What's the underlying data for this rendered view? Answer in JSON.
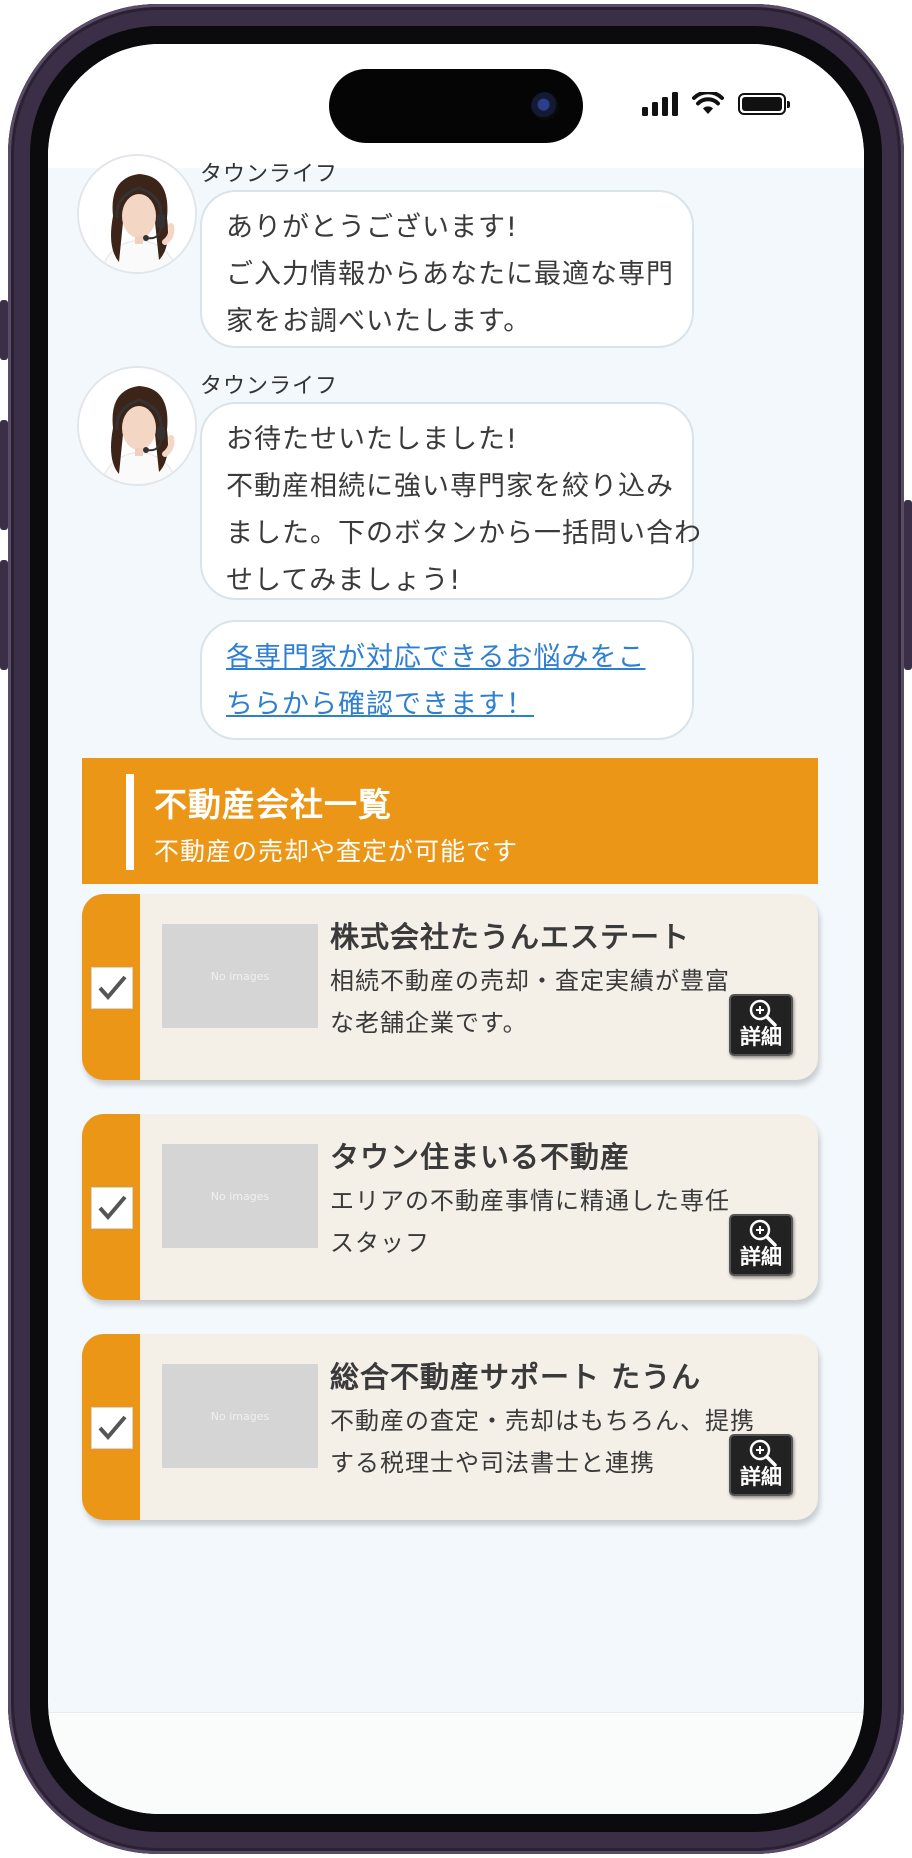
{
  "status_bar": {
    "signal_icon": "cellular-signal-icon",
    "wifi_icon": "wifi-icon",
    "battery_icon": "battery-icon",
    "battery_level": 1.0
  },
  "chat": {
    "messages": [
      {
        "sender": "タウンライフ",
        "lines": [
          "ありがとうございます!",
          "ご入力情報からあなたに最適な専門",
          "家をお調べいたします。"
        ]
      },
      {
        "sender": "タウンライフ",
        "lines": [
          "お待たせいたしました!",
          "不動産相続に強い専門家を絞り込み",
          "ました。下のボタンから一括問い合わ",
          "せしてみましょう!"
        ]
      }
    ],
    "link": {
      "lines": [
        "各専門家が対応できるお悩みをこ",
        "ちらから確認できます！"
      ]
    }
  },
  "section": {
    "title": "不動産会社一覧",
    "subtitle": "不動産の売却や査定が可能です"
  },
  "companies": [
    {
      "name": "株式会社たうんエステート",
      "desc_lines": [
        "相続不動産の売却・査定実績が豊富",
        "な老舗企業です。"
      ],
      "thumb_text": "No images",
      "detail_label": "詳細",
      "checked": true
    },
    {
      "name": "タウン住まいる不動産",
      "desc_lines": [
        "エリアの不動産事情に精通した専任",
        "スタッフ"
      ],
      "thumb_text": "No images",
      "detail_label": "詳細",
      "checked": true
    },
    {
      "name": "総合不動産サポート たうん",
      "desc_lines": [
        "不動産の査定・売却はもちろん、提携",
        "する税理士や司法書士と連携"
      ],
      "thumb_text": "No images",
      "detail_label": "詳細",
      "checked": true
    }
  ],
  "colors": {
    "accent": "#eb9616",
    "link": "#2f7fd1",
    "background": "#f2f8fc",
    "card": "#f4f0e8"
  }
}
